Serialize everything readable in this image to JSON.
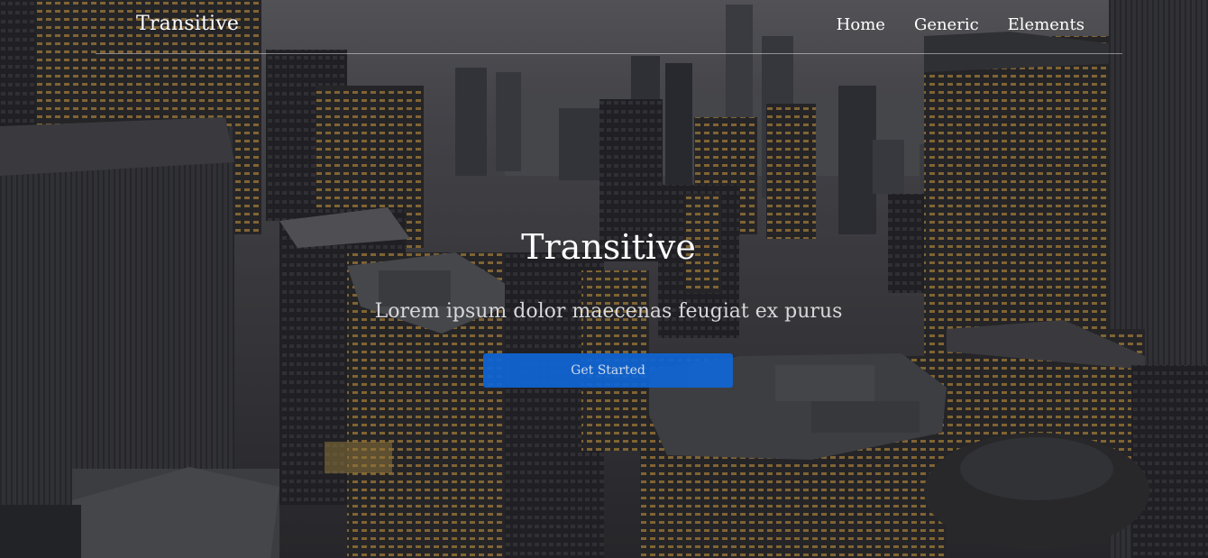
{
  "header": {
    "logo": "Transitive",
    "nav": [
      {
        "label": "Home"
      },
      {
        "label": "Generic"
      },
      {
        "label": "Elements"
      }
    ]
  },
  "hero": {
    "title": "Transitive",
    "subtitle": "Lorem ipsum dolor maecenas feugiat ex purus",
    "cta_label": "Get Started"
  },
  "colors": {
    "accent": "#0f66d6",
    "text": "#ffffff",
    "overlay": "#1e1e22"
  }
}
